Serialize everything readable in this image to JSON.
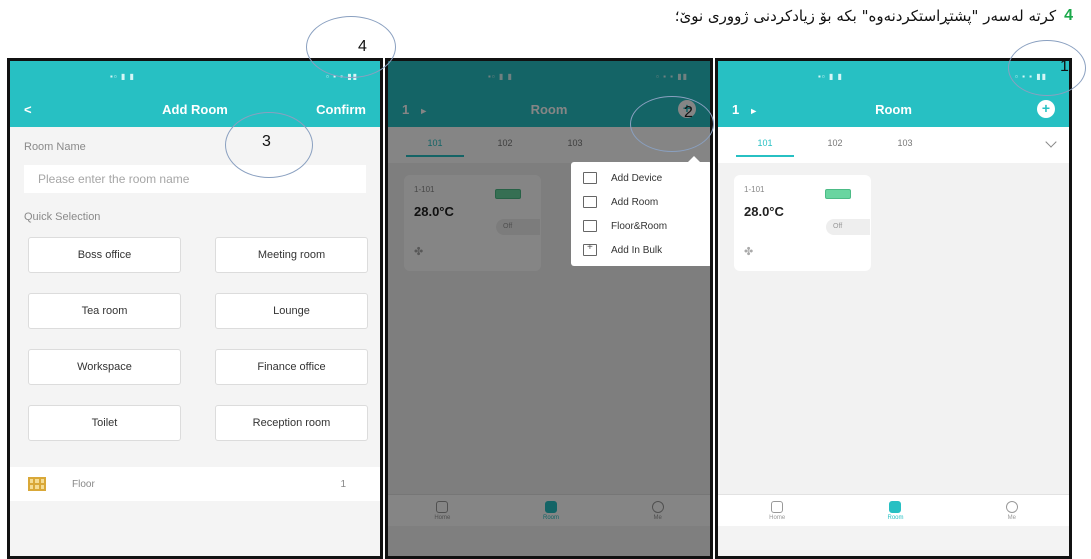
{
  "instruction": {
    "number": "4",
    "text": "کرتە لەسەر \"پشتڕاستکردنەوە\" بکە بۆ زیادکردنی ژووری نوێ؛"
  },
  "add_room": {
    "back_label": "<",
    "title": "Add Room",
    "confirm_label": "Confirm",
    "room_name_label": "Room Name",
    "room_name_placeholder": "Please enter the room name",
    "quick_label": "Quick Selection",
    "quick_items": [
      "Boss office",
      "Meeting room",
      "Tea room",
      "Lounge",
      "Workspace",
      "Finance office",
      "Toilet",
      "Reception room"
    ],
    "floor_label": "Floor",
    "floor_value": "1"
  },
  "room_screen": {
    "floor_selector": "1",
    "title": "Room",
    "tabs": [
      "101",
      "102",
      "103"
    ],
    "card": {
      "id": "1-101",
      "temp": "28.0°C",
      "state": "Off"
    },
    "nav": [
      "Home",
      "Room",
      "Me"
    ]
  },
  "popup_menu": [
    "Add Device",
    "Add Room",
    "Floor&Room",
    "Add In Bulk"
  ],
  "callouts": [
    "1",
    "2",
    "3",
    "4"
  ],
  "colors": {
    "accent": "#27c0c3",
    "instruction_number": "#1aa84a"
  }
}
